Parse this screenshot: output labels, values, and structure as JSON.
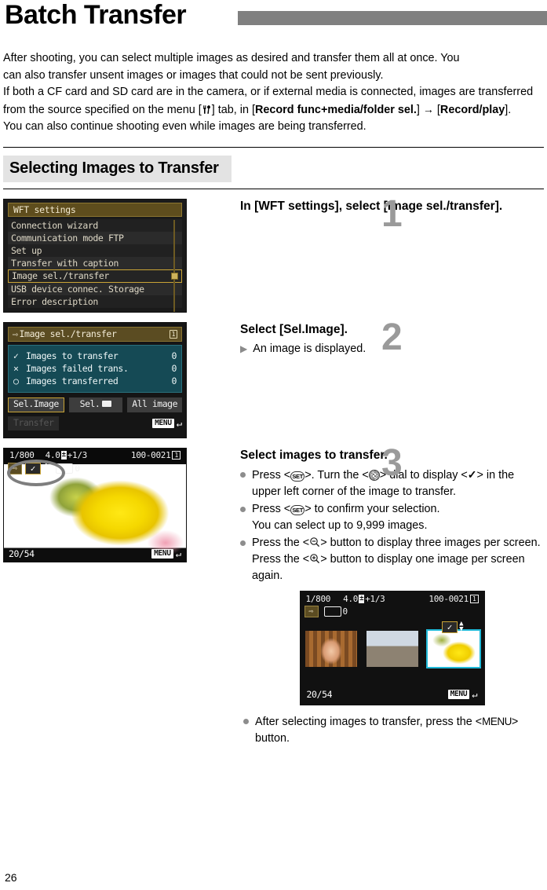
{
  "page": {
    "title": "Batch Transfer",
    "number": "26"
  },
  "intro": {
    "l1": "After shooting, you can select multiple images as desired and transfer them all at once. You",
    "l2": "can also transfer unsent images or images that could not be sent previously.",
    "l3a": "If both a CF card and SD card are in the camera, or if external media is connected, images are",
    "l3b": "transferred from the source specified on the menu [",
    "l3c": "] tab, in [",
    "l3_bold": "Record func+media/folder sel.",
    "l3d": "] ",
    "arrow": "→",
    "l3e": " [",
    "l3_bold2": "Record/play",
    "l3f": "].",
    "l4": "You can also continue shooting even while images are being transferred.",
    "menu_tab_icon": "setup-wrench-icon"
  },
  "section": {
    "heading": "Selecting Images to Transfer"
  },
  "steps": [
    {
      "num": "1",
      "title": "In [WFT settings], select [Image sel./transfer]."
    },
    {
      "num": "2",
      "title": "Select [Sel.Image].",
      "result": "An image is displayed."
    },
    {
      "num": "3",
      "title": "Select images to transfer.",
      "bullets": [
        {
          "pre": "Press <",
          "g1": "SET",
          "mid": ">. Turn the <",
          "g2": "dial",
          "mid2": "> dial to display <",
          "g3": "✓",
          "post": "> in the upper left corner of the image to transfer."
        },
        {
          "pre": "Press <",
          "g1": "SET",
          "post": "> to confirm your selection.",
          "line2": "You can select up to 9,999 images."
        },
        {
          "pre": "Press the <",
          "g1": "zoom-out",
          "mid": "> button to display three images per screen. Press the <",
          "g2": "zoom-in",
          "post": "> button to display one image per screen again."
        }
      ],
      "final_bullet_a": "After selecting images to transfer, press the <",
      "final_bullet_menu": "MENU",
      "final_bullet_b": "> button."
    }
  ],
  "screens": {
    "wft_settings": {
      "title": "WFT settings",
      "items": [
        "Connection wizard",
        "Communication mode FTP",
        "Set up",
        "Transfer with caption",
        "Image sel./transfer",
        "USB device connec. Storage",
        "Error description"
      ],
      "selected_index": 4,
      "highlight_color": "#c9a436",
      "titlebar_color": "#5e4d1d"
    },
    "image_sel_transfer": {
      "title": "Image sel./transfer",
      "card_tag": "1",
      "rows": [
        {
          "mark": "✓",
          "label": "Images to transfer",
          "value": "0"
        },
        {
          "mark": "×",
          "label": "Images failed trans.",
          "value": "0"
        },
        {
          "mark": "○",
          "label": "Images transferred",
          "value": "0"
        }
      ],
      "buttons": [
        "Sel.Image",
        "Sel.",
        "All image"
      ],
      "selected_button": "Sel.Image",
      "transfer_label": "Transfer",
      "menu_label": "MENU",
      "panel_color": "#154a55"
    },
    "playback_single": {
      "shutter": "1/800",
      "aperture": "4.0",
      "exp_comp": "+1/3",
      "file_no": "100-0021",
      "card_tag": "1",
      "copies": "0",
      "check": "✓",
      "counter": "20/54",
      "menu_label": "MENU",
      "annotation": "highlight-ellipse"
    },
    "playback_index": {
      "shutter": "1/800",
      "aperture": "4.0",
      "exp_comp": "+1/3",
      "file_no": "100-0021",
      "card_tag": "1",
      "copies": "0",
      "check": "✓",
      "counter": "20/54",
      "menu_label": "MENU",
      "current_index": 2,
      "thumb_count": 3,
      "cursor_color": "#20b9d8"
    }
  }
}
